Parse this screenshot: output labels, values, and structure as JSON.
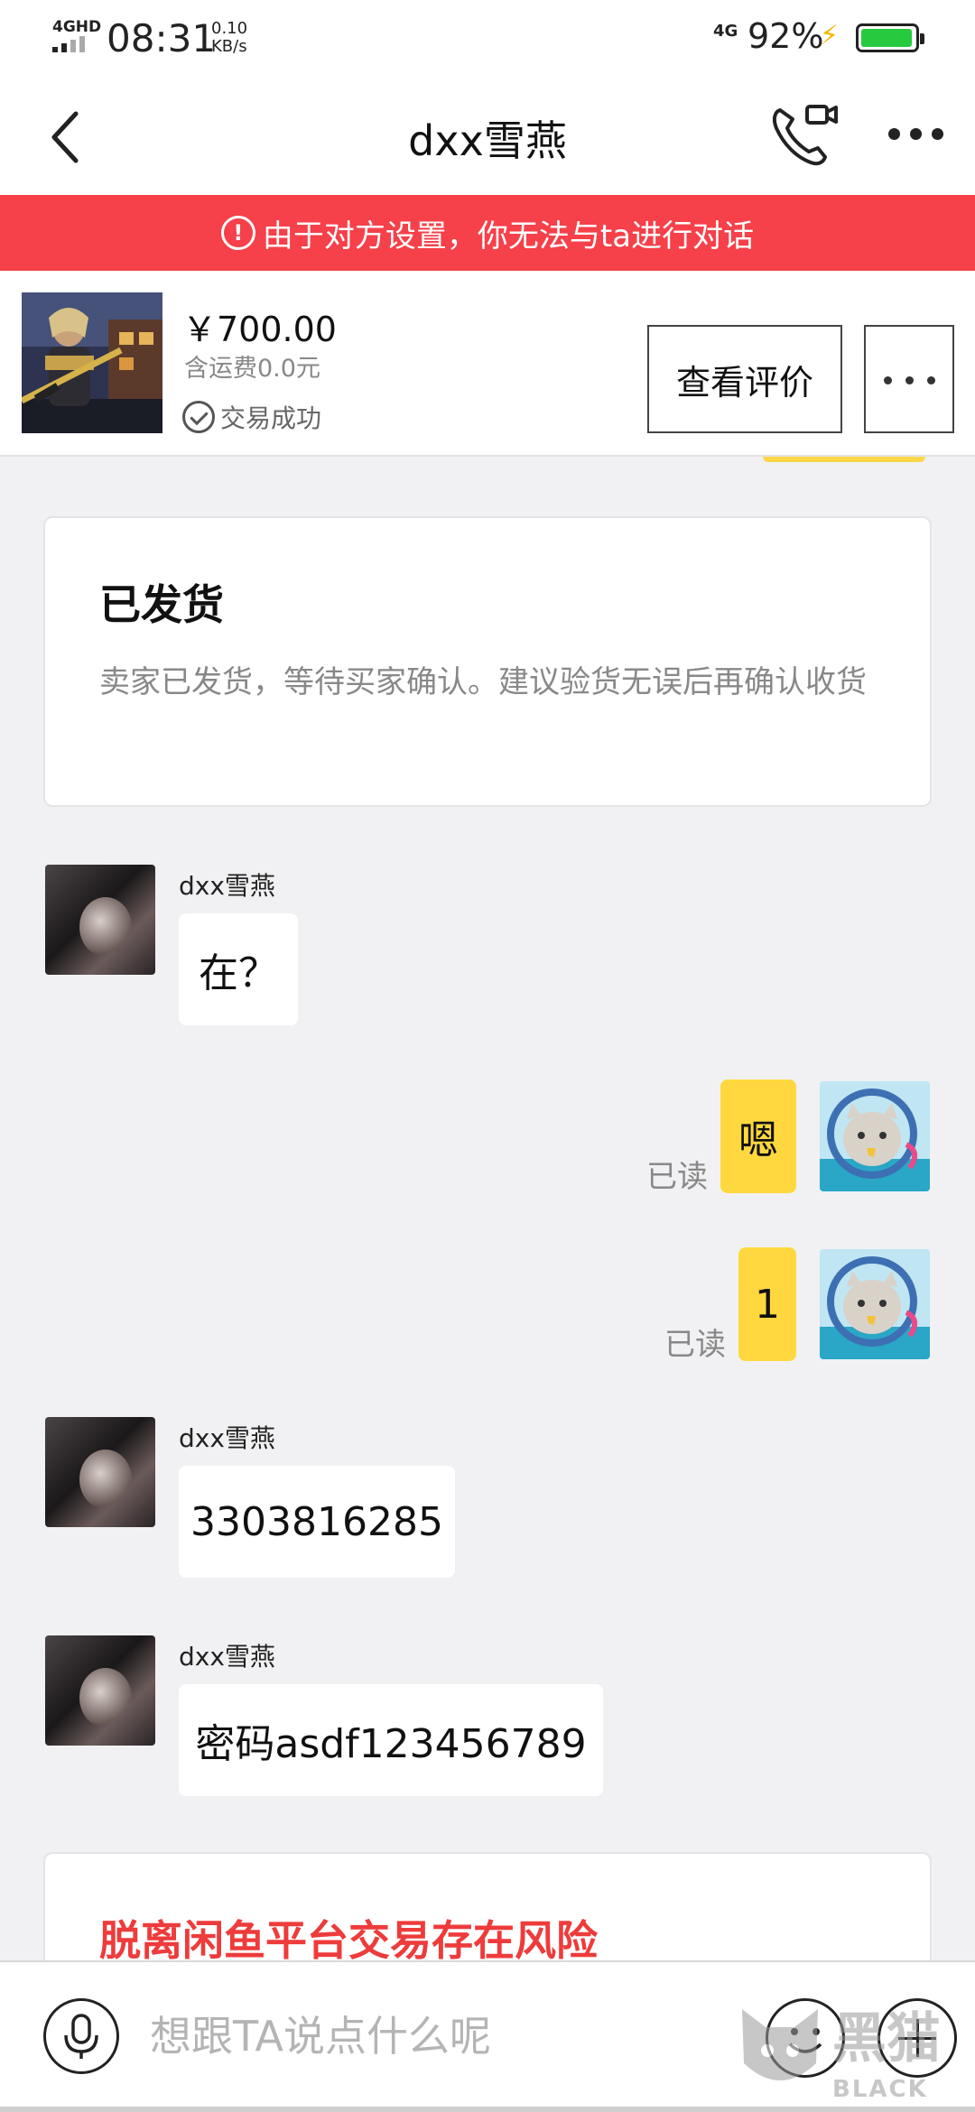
{
  "status_bar": {
    "network": "4GHD",
    "time": "08:31",
    "speed_value": "0.10",
    "speed_unit": "KB/s",
    "mobile_network": "4G",
    "battery": "92%"
  },
  "header": {
    "title": "dxx雪燕"
  },
  "banner": {
    "text": "由于对方设置，你无法与ta进行对话"
  },
  "product": {
    "price": "￥700.00",
    "shipping": "含运费0.0元",
    "status": "交易成功",
    "review_button": "查看评价"
  },
  "system_card": {
    "title": "已发货",
    "body": "卖家已发货，等待买家确认。建议验货无误后再确认收货"
  },
  "messages": [
    {
      "from": "dxx雪燕",
      "sender_name": "dxx雪燕",
      "text": "在？"
    },
    {
      "from": "self",
      "text": "嗯",
      "read": "已读"
    },
    {
      "from": "self",
      "text": "1",
      "read": "已读"
    },
    {
      "from": "dxx雪燕",
      "sender_name": "dxx雪燕",
      "text": "3303816285"
    },
    {
      "from": "dxx雪燕",
      "sender_name": "dxx雪燕",
      "text": "密码asdf123456789"
    }
  ],
  "risk_card": {
    "title": "脱离闲鱼平台交易存在风险"
  },
  "input": {
    "placeholder": "想跟TA说点什么呢"
  },
  "watermark": {
    "text": "黑猫",
    "sub": "BLACK CAT"
  },
  "colors": {
    "banner_bg": "#f6404a",
    "self_bubble": "#ffd83f",
    "page_bg": "#f1f1f3",
    "risk_text": "#ee3b3b"
  },
  "icons": [
    "back-arrow-icon",
    "video-call-icon",
    "more-icon",
    "warning-icon",
    "check-icon",
    "microphone-icon",
    "emoji-icon",
    "plus-icon"
  ]
}
